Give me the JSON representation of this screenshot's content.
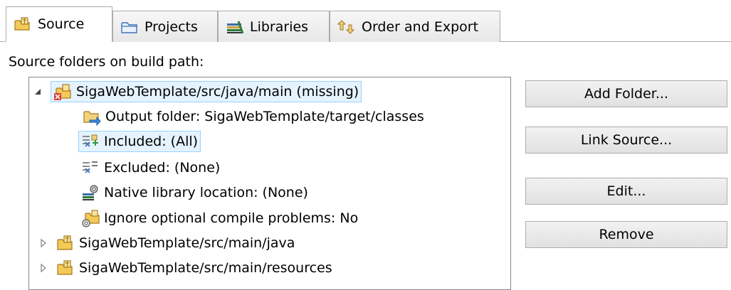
{
  "tabs": [
    {
      "label": "Source",
      "icon": "source-folder-icon",
      "selected": true
    },
    {
      "label": "Projects",
      "icon": "projects-icon",
      "selected": false
    },
    {
      "label": "Libraries",
      "icon": "libraries-icon",
      "selected": false
    },
    {
      "label": "Order and Export",
      "icon": "order-export-icon",
      "selected": false
    }
  ],
  "section_label": "Source folders on build path:",
  "tree": {
    "items": [
      {
        "label": "SigaWebTemplate/src/java/main (missing)",
        "icon": "missing-source-folder-icon",
        "expanded": true,
        "selected": true
      },
      {
        "label": "Output folder: SigaWebTemplate/target/classes",
        "icon": "output-folder-icon"
      },
      {
        "label": "Included: (All)",
        "icon": "inclusion-filter-icon",
        "selected": true
      },
      {
        "label": "Excluded: (None)",
        "icon": "exclusion-filter-icon"
      },
      {
        "label": "Native library location: (None)",
        "icon": "native-library-icon"
      },
      {
        "label": "Ignore optional compile problems: No",
        "icon": "ignore-problems-icon"
      },
      {
        "label": "SigaWebTemplate/src/main/java",
        "icon": "source-folder-icon",
        "expanded": false
      },
      {
        "label": "SigaWebTemplate/src/main/resources",
        "icon": "source-folder-icon",
        "expanded": false
      }
    ]
  },
  "buttons": {
    "add_folder": "Add Folder...",
    "link_source": "Link Source...",
    "edit": "Edit...",
    "remove": "Remove"
  }
}
